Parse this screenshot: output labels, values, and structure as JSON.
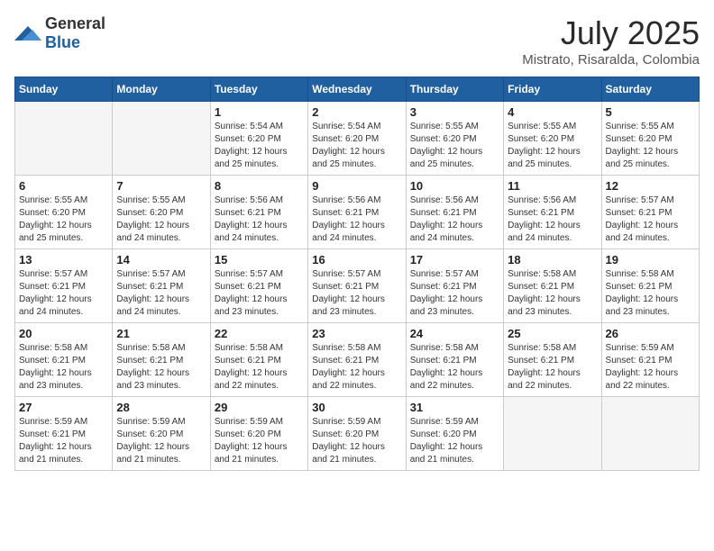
{
  "header": {
    "logo_general": "General",
    "logo_blue": "Blue",
    "month_year": "July 2025",
    "location": "Mistrato, Risaralda, Colombia"
  },
  "weekdays": [
    "Sunday",
    "Monday",
    "Tuesday",
    "Wednesday",
    "Thursday",
    "Friday",
    "Saturday"
  ],
  "weeks": [
    [
      {
        "day": "",
        "sunrise": "",
        "sunset": "",
        "daylight": "",
        "empty": true
      },
      {
        "day": "",
        "sunrise": "",
        "sunset": "",
        "daylight": "",
        "empty": true
      },
      {
        "day": "1",
        "sunrise": "Sunrise: 5:54 AM",
        "sunset": "Sunset: 6:20 PM",
        "daylight": "Daylight: 12 hours and 25 minutes."
      },
      {
        "day": "2",
        "sunrise": "Sunrise: 5:54 AM",
        "sunset": "Sunset: 6:20 PM",
        "daylight": "Daylight: 12 hours and 25 minutes."
      },
      {
        "day": "3",
        "sunrise": "Sunrise: 5:55 AM",
        "sunset": "Sunset: 6:20 PM",
        "daylight": "Daylight: 12 hours and 25 minutes."
      },
      {
        "day": "4",
        "sunrise": "Sunrise: 5:55 AM",
        "sunset": "Sunset: 6:20 PM",
        "daylight": "Daylight: 12 hours and 25 minutes."
      },
      {
        "day": "5",
        "sunrise": "Sunrise: 5:55 AM",
        "sunset": "Sunset: 6:20 PM",
        "daylight": "Daylight: 12 hours and 25 minutes."
      }
    ],
    [
      {
        "day": "6",
        "sunrise": "Sunrise: 5:55 AM",
        "sunset": "Sunset: 6:20 PM",
        "daylight": "Daylight: 12 hours and 25 minutes."
      },
      {
        "day": "7",
        "sunrise": "Sunrise: 5:55 AM",
        "sunset": "Sunset: 6:20 PM",
        "daylight": "Daylight: 12 hours and 24 minutes."
      },
      {
        "day": "8",
        "sunrise": "Sunrise: 5:56 AM",
        "sunset": "Sunset: 6:21 PM",
        "daylight": "Daylight: 12 hours and 24 minutes."
      },
      {
        "day": "9",
        "sunrise": "Sunrise: 5:56 AM",
        "sunset": "Sunset: 6:21 PM",
        "daylight": "Daylight: 12 hours and 24 minutes."
      },
      {
        "day": "10",
        "sunrise": "Sunrise: 5:56 AM",
        "sunset": "Sunset: 6:21 PM",
        "daylight": "Daylight: 12 hours and 24 minutes."
      },
      {
        "day": "11",
        "sunrise": "Sunrise: 5:56 AM",
        "sunset": "Sunset: 6:21 PM",
        "daylight": "Daylight: 12 hours and 24 minutes."
      },
      {
        "day": "12",
        "sunrise": "Sunrise: 5:57 AM",
        "sunset": "Sunset: 6:21 PM",
        "daylight": "Daylight: 12 hours and 24 minutes."
      }
    ],
    [
      {
        "day": "13",
        "sunrise": "Sunrise: 5:57 AM",
        "sunset": "Sunset: 6:21 PM",
        "daylight": "Daylight: 12 hours and 24 minutes."
      },
      {
        "day": "14",
        "sunrise": "Sunrise: 5:57 AM",
        "sunset": "Sunset: 6:21 PM",
        "daylight": "Daylight: 12 hours and 24 minutes."
      },
      {
        "day": "15",
        "sunrise": "Sunrise: 5:57 AM",
        "sunset": "Sunset: 6:21 PM",
        "daylight": "Daylight: 12 hours and 23 minutes."
      },
      {
        "day": "16",
        "sunrise": "Sunrise: 5:57 AM",
        "sunset": "Sunset: 6:21 PM",
        "daylight": "Daylight: 12 hours and 23 minutes."
      },
      {
        "day": "17",
        "sunrise": "Sunrise: 5:57 AM",
        "sunset": "Sunset: 6:21 PM",
        "daylight": "Daylight: 12 hours and 23 minutes."
      },
      {
        "day": "18",
        "sunrise": "Sunrise: 5:58 AM",
        "sunset": "Sunset: 6:21 PM",
        "daylight": "Daylight: 12 hours and 23 minutes."
      },
      {
        "day": "19",
        "sunrise": "Sunrise: 5:58 AM",
        "sunset": "Sunset: 6:21 PM",
        "daylight": "Daylight: 12 hours and 23 minutes."
      }
    ],
    [
      {
        "day": "20",
        "sunrise": "Sunrise: 5:58 AM",
        "sunset": "Sunset: 6:21 PM",
        "daylight": "Daylight: 12 hours and 23 minutes."
      },
      {
        "day": "21",
        "sunrise": "Sunrise: 5:58 AM",
        "sunset": "Sunset: 6:21 PM",
        "daylight": "Daylight: 12 hours and 23 minutes."
      },
      {
        "day": "22",
        "sunrise": "Sunrise: 5:58 AM",
        "sunset": "Sunset: 6:21 PM",
        "daylight": "Daylight: 12 hours and 22 minutes."
      },
      {
        "day": "23",
        "sunrise": "Sunrise: 5:58 AM",
        "sunset": "Sunset: 6:21 PM",
        "daylight": "Daylight: 12 hours and 22 minutes."
      },
      {
        "day": "24",
        "sunrise": "Sunrise: 5:58 AM",
        "sunset": "Sunset: 6:21 PM",
        "daylight": "Daylight: 12 hours and 22 minutes."
      },
      {
        "day": "25",
        "sunrise": "Sunrise: 5:58 AM",
        "sunset": "Sunset: 6:21 PM",
        "daylight": "Daylight: 12 hours and 22 minutes."
      },
      {
        "day": "26",
        "sunrise": "Sunrise: 5:59 AM",
        "sunset": "Sunset: 6:21 PM",
        "daylight": "Daylight: 12 hours and 22 minutes."
      }
    ],
    [
      {
        "day": "27",
        "sunrise": "Sunrise: 5:59 AM",
        "sunset": "Sunset: 6:21 PM",
        "daylight": "Daylight: 12 hours and 21 minutes."
      },
      {
        "day": "28",
        "sunrise": "Sunrise: 5:59 AM",
        "sunset": "Sunset: 6:20 PM",
        "daylight": "Daylight: 12 hours and 21 minutes."
      },
      {
        "day": "29",
        "sunrise": "Sunrise: 5:59 AM",
        "sunset": "Sunset: 6:20 PM",
        "daylight": "Daylight: 12 hours and 21 minutes."
      },
      {
        "day": "30",
        "sunrise": "Sunrise: 5:59 AM",
        "sunset": "Sunset: 6:20 PM",
        "daylight": "Daylight: 12 hours and 21 minutes."
      },
      {
        "day": "31",
        "sunrise": "Sunrise: 5:59 AM",
        "sunset": "Sunset: 6:20 PM",
        "daylight": "Daylight: 12 hours and 21 minutes."
      },
      {
        "day": "",
        "sunrise": "",
        "sunset": "",
        "daylight": "",
        "empty": true
      },
      {
        "day": "",
        "sunrise": "",
        "sunset": "",
        "daylight": "",
        "empty": true
      }
    ]
  ]
}
